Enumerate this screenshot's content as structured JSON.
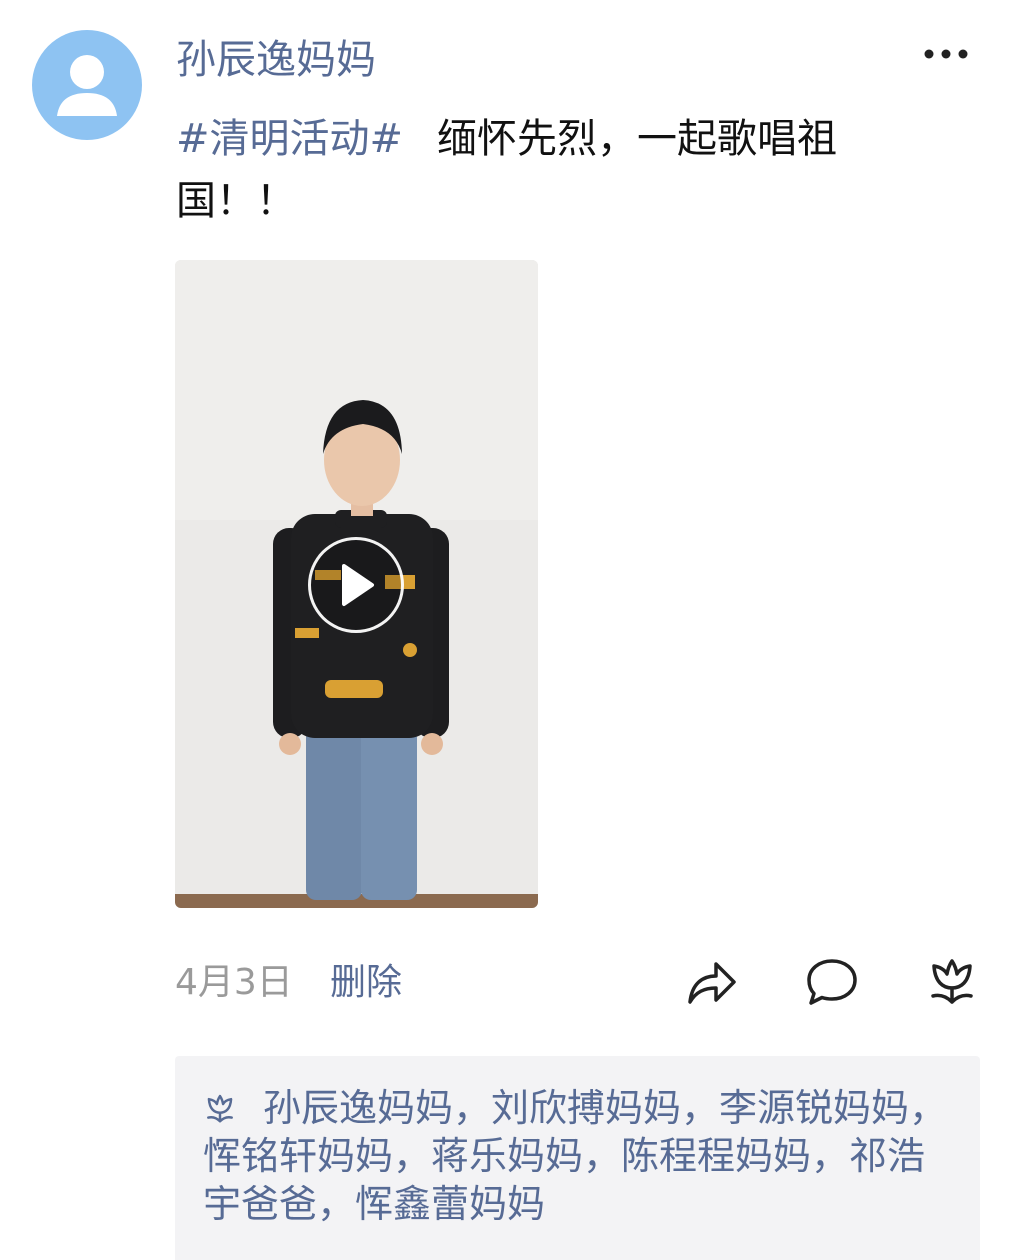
{
  "post": {
    "author": "孙辰逸妈妈",
    "hashtag": "#清明活动#",
    "body": "缅怀先烈，一起歌唱祖国！！",
    "time": "4月3日",
    "delete_label": "删除",
    "video": {
      "has_play_button": true
    }
  },
  "icons": {
    "avatar": "default-user-avatar",
    "more": "ellipsis-icon",
    "play": "play-icon",
    "share": "share-arrow-icon",
    "comment": "comment-bubble-icon",
    "like": "flower-like-icon"
  },
  "likes": {
    "names": "孙辰逸妈妈，刘欣搏妈妈，李源锐妈妈，恽铭轩妈妈，蒋乐妈妈，陈程程妈妈，祁浩宇爸爸，恽鑫蕾妈妈"
  },
  "colors": {
    "link": "#576b95",
    "avatar_bg": "#8ec3f2",
    "panel_bg": "#f3f3f5",
    "time": "#9a9a9a",
    "text": "#111111"
  }
}
